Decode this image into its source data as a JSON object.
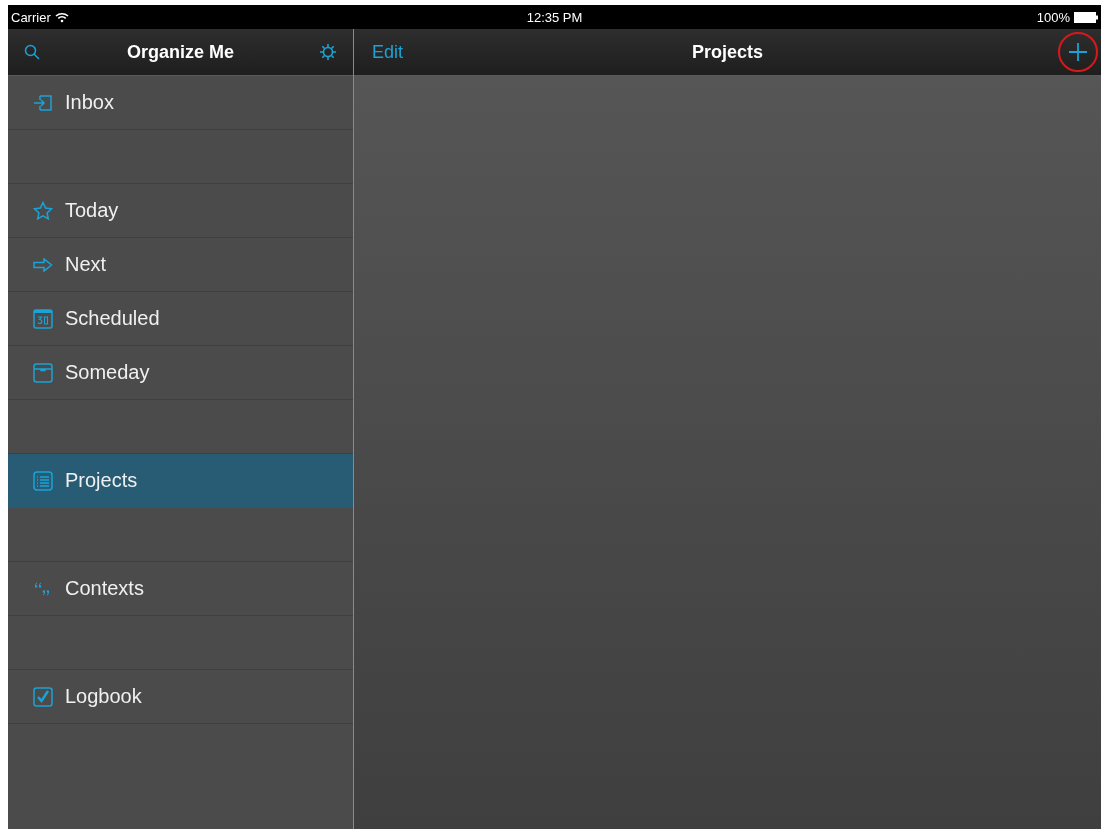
{
  "status_bar": {
    "carrier": "Carrier",
    "time": "12:35 PM",
    "battery": "100%"
  },
  "sidebar": {
    "title": "Organize Me",
    "sections": [
      [
        {
          "label": "Inbox",
          "kind": "inbox",
          "selected": false
        }
      ],
      [
        {
          "label": "Today",
          "kind": "today",
          "selected": false
        },
        {
          "label": "Next",
          "kind": "next",
          "selected": false
        },
        {
          "label": "Scheduled",
          "kind": "scheduled",
          "selected": false
        },
        {
          "label": "Someday",
          "kind": "someday",
          "selected": false
        }
      ],
      [
        {
          "label": "Projects",
          "kind": "projects",
          "selected": true
        }
      ],
      [
        {
          "label": "Contexts",
          "kind": "contexts",
          "selected": false
        }
      ],
      [
        {
          "label": "Logbook",
          "kind": "logbook",
          "selected": false
        }
      ]
    ]
  },
  "main": {
    "title": "Projects",
    "edit_button": "Edit",
    "add_button": {
      "highlighted": true
    }
  }
}
